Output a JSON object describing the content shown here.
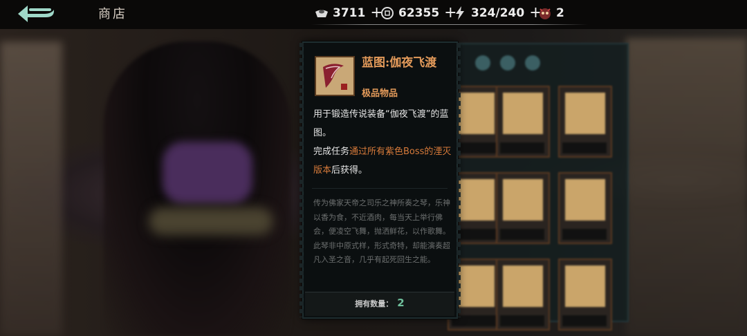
{
  "header": {
    "title": "商店",
    "back_icon": "back-arrow-icon",
    "resources": [
      {
        "icon": "ingot-icon",
        "value": "3711"
      },
      {
        "icon": "coin-icon",
        "value": "62355"
      },
      {
        "icon": "lightning-icon",
        "value": "324/240"
      },
      {
        "icon": "demon-mask-icon",
        "value": "2"
      }
    ]
  },
  "tooltip": {
    "item_name": "蓝图:伽夜飞渡",
    "rarity": "极品物品",
    "desc_line1": "用于锻造传说装备“伽夜飞渡”的蓝图。",
    "desc_prefix": "完成任务",
    "desc_highlight": "通过所有紫色Boss的湮灭版本",
    "desc_suffix": "后获得。",
    "lore": "传为佛家天帝之司乐之神所奏之琴，乐神以香为食，不近酒肉，每当天上举行佛会，便凌空飞舞，抛洒鲜花，以作歌舞。此琴非中原式样，形式奇特，却能演奏超凡入圣之音，几乎有起死回生之能。",
    "owned_label": "拥有数量：",
    "owned_count": "2"
  },
  "colors": {
    "accent": "#e39a5a",
    "highlight": "#d67a3a",
    "quantity": "#6fbf9c"
  }
}
